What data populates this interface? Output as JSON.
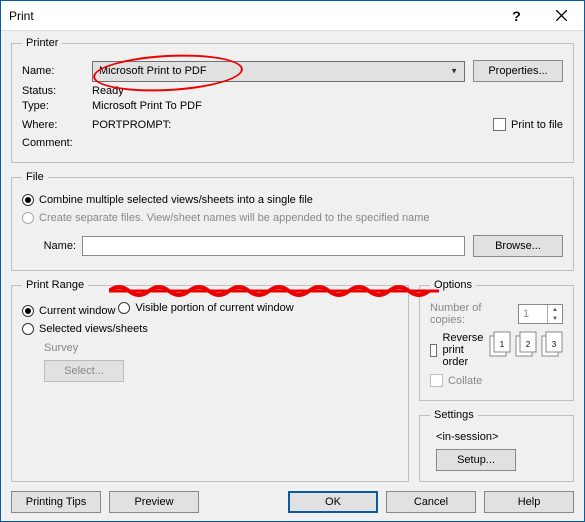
{
  "window": {
    "title": "Print"
  },
  "printer": {
    "legend": "Printer",
    "name_label": "Name:",
    "name_value": "Microsoft Print to PDF",
    "properties_btn": "Properties...",
    "status_label": "Status:",
    "status_value": "Ready",
    "type_label": "Type:",
    "type_value": "Microsoft Print To PDF",
    "where_label": "Where:",
    "where_value": "PORTPROMPT:",
    "comment_label": "Comment:",
    "print_to_file": "Print to file"
  },
  "file": {
    "legend": "File",
    "combine": "Combine multiple selected views/sheets into a single file",
    "separate": "Create separate files. View/sheet names will be appended to the specified name",
    "name_label": "Name:",
    "browse_btn": "Browse..."
  },
  "range": {
    "legend": "Print Range",
    "current": "Current window",
    "visible": "Visible portion of current window",
    "selected": "Selected views/sheets",
    "survey": "Survey",
    "select_btn": "Select..."
  },
  "options": {
    "legend": "Options",
    "copies_label": "Number of copies:",
    "copies_value": "1",
    "reverse": "Reverse print order",
    "collate": "Collate"
  },
  "settings": {
    "legend": "Settings",
    "session": "<in-session>",
    "setup_btn": "Setup..."
  },
  "buttons": {
    "tips": "Printing Tips",
    "preview": "Preview",
    "ok": "OK",
    "cancel": "Cancel",
    "help": "Help"
  }
}
